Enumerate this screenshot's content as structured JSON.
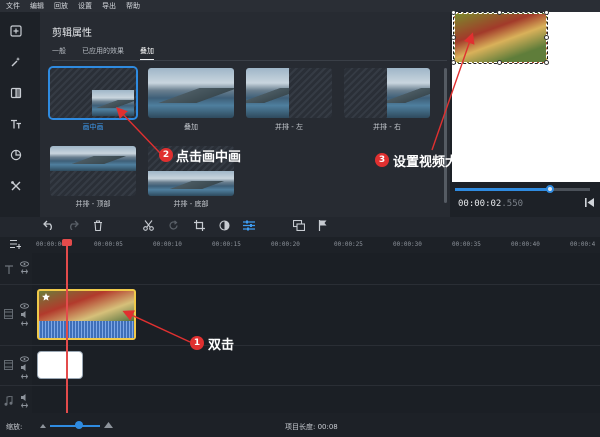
{
  "menu": [
    "文件",
    "编辑",
    "回放",
    "设置",
    "导出",
    "帮助"
  ],
  "sidebar_icons": [
    "import-icon",
    "magic-wand-icon",
    "transitions-icon",
    "text-icon",
    "sticker-icon",
    "tools-icon"
  ],
  "panel": {
    "title": "剪辑属性",
    "tabs": [
      "一般",
      "已应用的效果",
      "叠加"
    ],
    "active_tab": "叠加",
    "items": [
      {
        "label": "画中画",
        "selected": true
      },
      {
        "label": "叠加",
        "selected": false
      },
      {
        "label": "并排 - 左",
        "selected": false
      },
      {
        "label": "并排 - 右",
        "selected": false
      },
      {
        "label": "并排 - 顶部",
        "selected": false
      },
      {
        "label": "并排 - 底部",
        "selected": false
      }
    ]
  },
  "preview": {
    "timecode_main": "00:00:02",
    "timecode_ms": ".550",
    "position_fraction": 0.68
  },
  "timeline": {
    "ticks": [
      "00:00:00",
      "00:00:05",
      "00:00:10",
      "00:00:15",
      "00:00:20",
      "00:00:25",
      "00:00:30",
      "00:00:35",
      "00:00:40",
      "00:00:4"
    ]
  },
  "status": {
    "zoom_label": "缩放:",
    "project_length": "项目长度: 00:08"
  },
  "annotations": {
    "a1": {
      "num": "1",
      "text": "双击"
    },
    "a2": {
      "num": "2",
      "text": "点击画中画"
    },
    "a3": {
      "num": "3",
      "text": "设置视频大小位置"
    }
  },
  "colors": {
    "accent": "#2f8be0",
    "annotation": "#e03030",
    "selection": "#f0c94a",
    "playhead": "#e34b4b"
  }
}
